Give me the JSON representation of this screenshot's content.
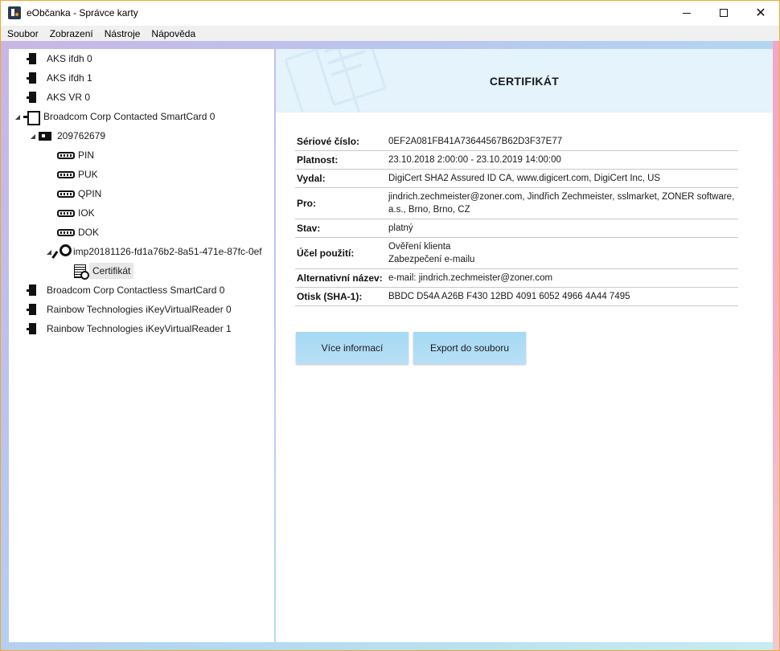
{
  "window": {
    "title": "eObčanka - Správce karty",
    "minimize_glyph": "—",
    "close_glyph": "✕"
  },
  "menu": [
    "Soubor",
    "Zobrazení",
    "Nástroje",
    "Nápověda"
  ],
  "tree": {
    "readers": [
      {
        "label": "AKS ifdh 0"
      },
      {
        "label": "AKS ifdh 1"
      },
      {
        "label": "AKS VR 0"
      },
      {
        "label": "Broadcom Corp Contacted SmartCard 0"
      },
      {
        "label": "Broadcom Corp Contactless SmartCard 0"
      },
      {
        "label": "Rainbow Technologies iKeyVirtualReader 0"
      },
      {
        "label": "Rainbow Technologies iKeyVirtualReader 1"
      }
    ],
    "card": {
      "label": "209762679"
    },
    "pins": [
      "PIN",
      "PUK",
      "QPIN",
      "IOK",
      "DOK"
    ],
    "key": {
      "label": "imp20181126-fd1a76b2-8a51-471e-87fc-0ef"
    },
    "certificate": {
      "label": "Certifikát"
    }
  },
  "cert": {
    "title": "CERTIFIKÁT",
    "rows": [
      {
        "label": "Sériové číslo:",
        "value": "0EF2A081FB41A73644567B62D3F37E77"
      },
      {
        "label": "Platnost:",
        "value": "23.10.2018 2:00:00 - 23.10.2019 14:00:00"
      },
      {
        "label": "Vydal:",
        "value": "DigiCert SHA2 Assured ID CA, www.digicert.com, DigiCert Inc, US"
      },
      {
        "label": "Pro:",
        "value": "jindrich.zechmeister@zoner.com, Jindřich Zechmeister, sslmarket, ZONER software, a.s., Brno, Brno, CZ"
      },
      {
        "label": "Stav:",
        "value": "platný"
      },
      {
        "label": "Účel použití:",
        "value": "Ověření klienta\nZabezpečení e-mailu"
      },
      {
        "label": "Alternativní název:",
        "value": "e-mail: jindrich.zechmeister@zoner.com"
      },
      {
        "label": "Otisk (SHA-1):",
        "value": "BBDC D54A A26B F430 12BD 4091 6052 4966 4A44 7495"
      }
    ]
  },
  "buttons": {
    "more_info": "Více informací",
    "export": "Export do souboru"
  },
  "colors": {
    "accent_border": "#f0a830",
    "header_bg": "#e4f3fc",
    "button_bg": "#a6d9f4"
  }
}
